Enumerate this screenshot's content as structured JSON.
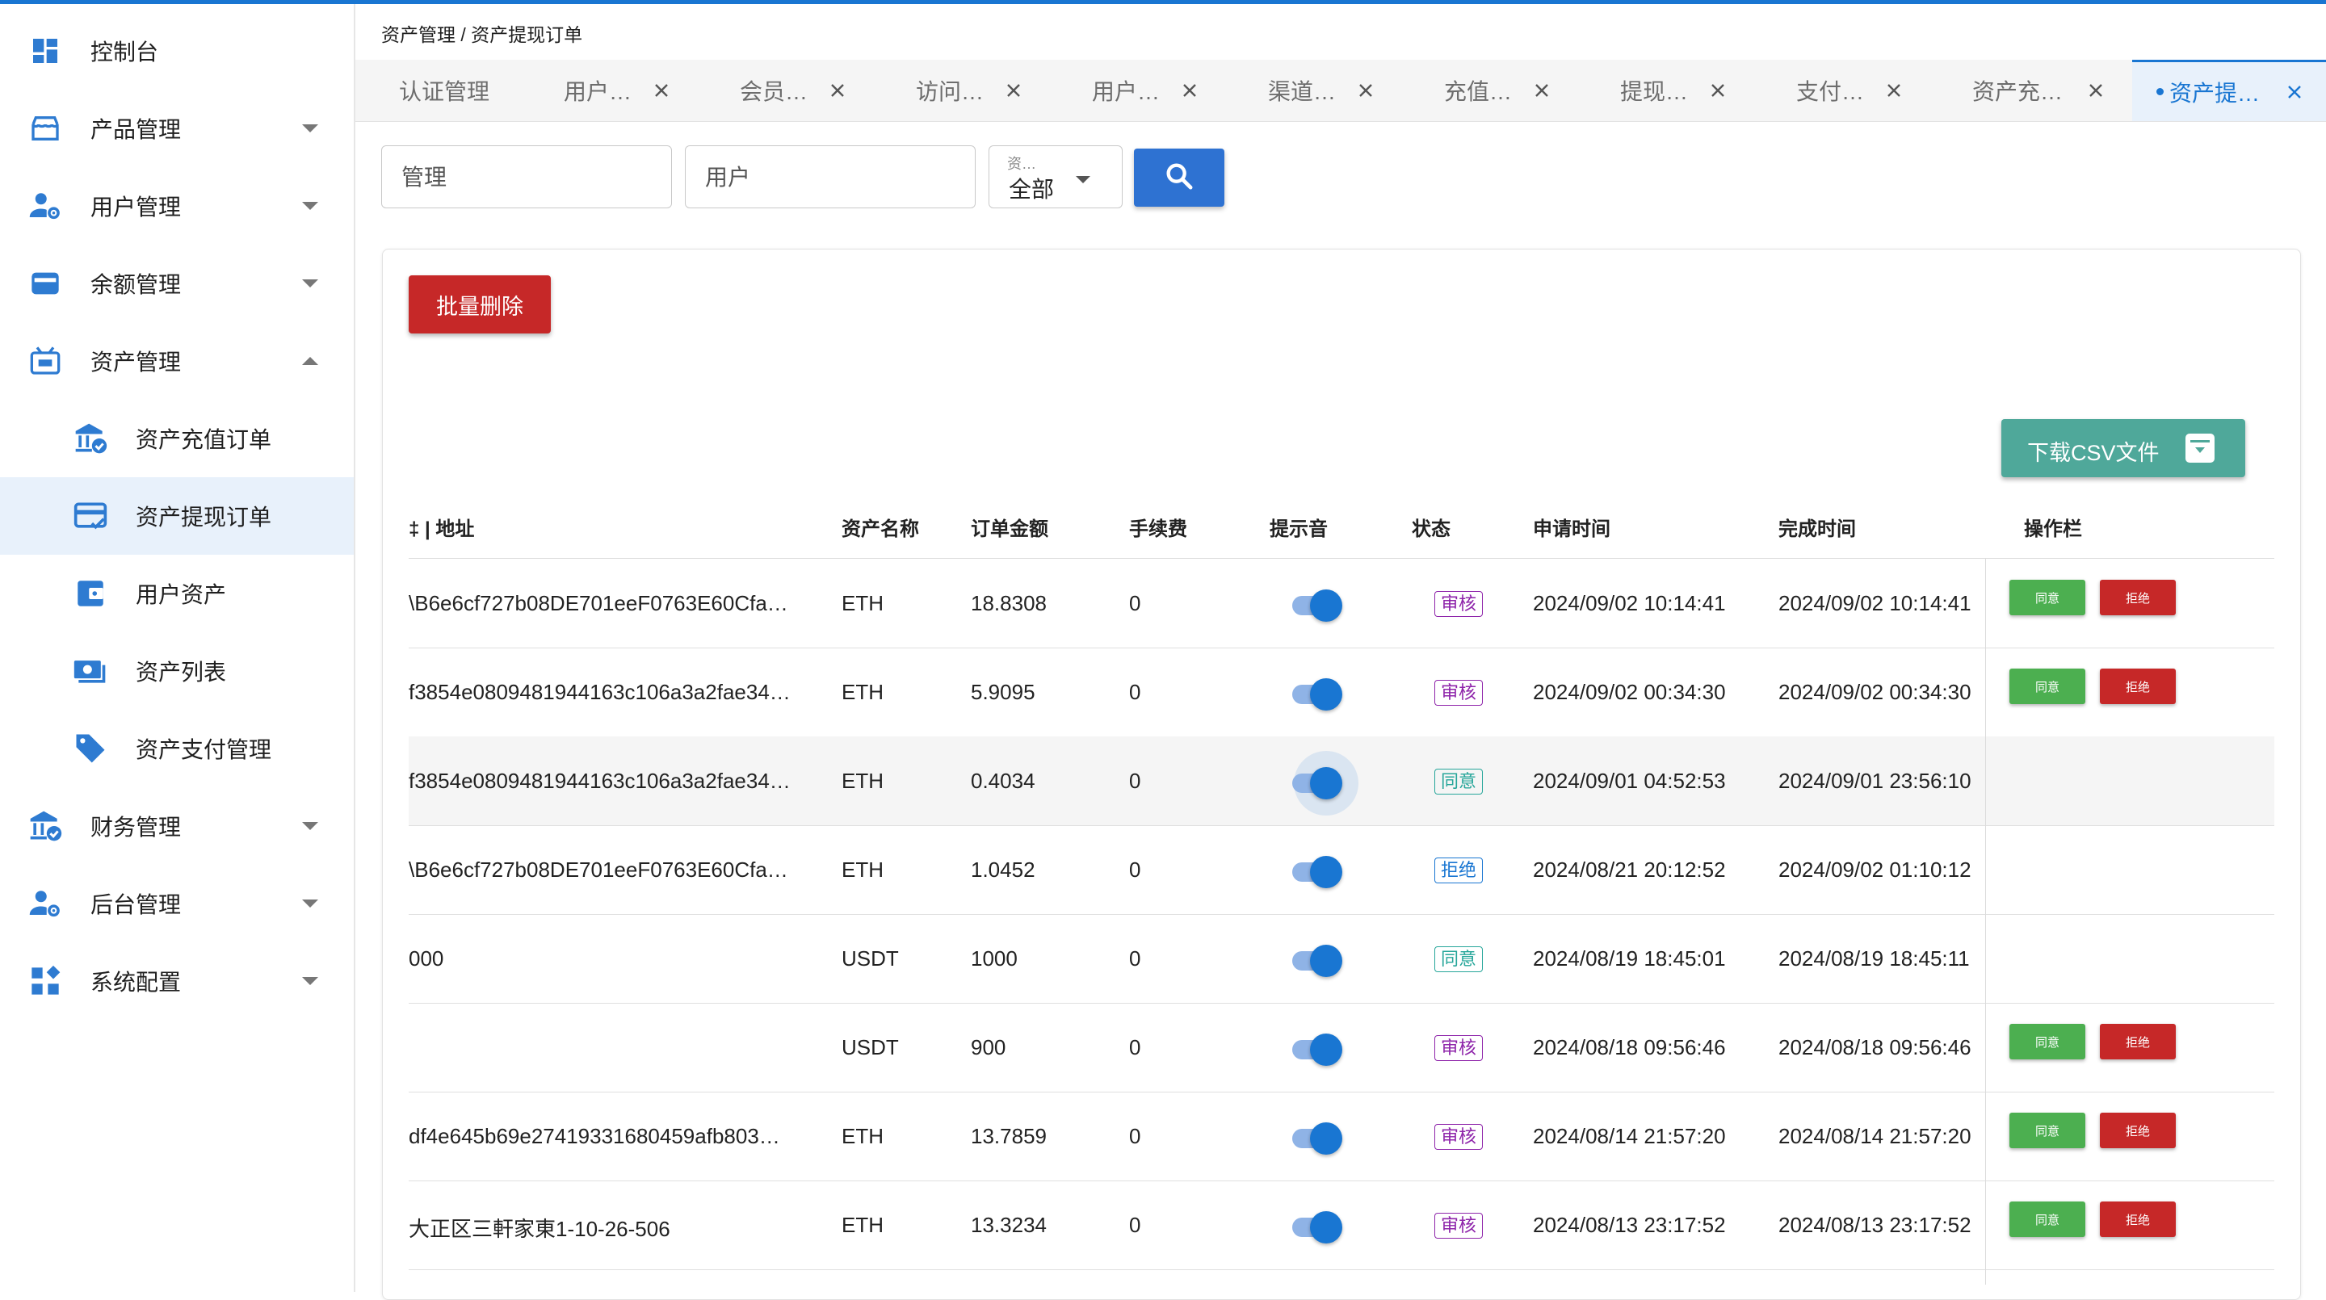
{
  "colors": {
    "primary": "#1976d2",
    "danger": "#c62828",
    "success": "#4caf50",
    "csv": "#4fa89a",
    "audit": "#8e24aa",
    "agree": "#26a69a"
  },
  "sidebar": {
    "items": [
      {
        "label": "控制台",
        "icon": "dashboard-icon"
      },
      {
        "label": "产品管理",
        "icon": "store-icon"
      },
      {
        "label": "用户管理",
        "icon": "user-settings-icon"
      },
      {
        "label": "余额管理",
        "icon": "wallet-card-icon"
      },
      {
        "label": "资产管理",
        "icon": "asset-box-icon"
      },
      {
        "label": "资产充值订单",
        "icon": "bank-check-icon"
      },
      {
        "label": "资产提现订单",
        "icon": "card-check-icon"
      },
      {
        "label": "用户资产",
        "icon": "wallet-icon"
      },
      {
        "label": "资产列表",
        "icon": "cash-icon"
      },
      {
        "label": "资产支付管理",
        "icon": "tag-icon"
      },
      {
        "label": "财务管理",
        "icon": "bank-icon"
      },
      {
        "label": "后台管理",
        "icon": "admin-settings-icon"
      },
      {
        "label": "系统配置",
        "icon": "widgets-icon"
      }
    ]
  },
  "breadcrumb": "资产管理 / 资产提现订单",
  "tabs": [
    "认证管理",
    "用户…",
    "会员…",
    "访问…",
    "用户…",
    "渠道…",
    "充值…",
    "提现…",
    "支付…",
    "资产充…",
    "资产提…"
  ],
  "filters": {
    "manage_placeholder": "管理",
    "user_placeholder": "用户",
    "select_label": "资…",
    "select_value": "全部"
  },
  "actions": {
    "batch_delete": "批量删除",
    "download_csv": "下载CSV文件"
  },
  "table": {
    "headers": [
      "‡ | 地址",
      "资产名称",
      "订单金额",
      "手续费",
      "提示音",
      "状态",
      "申请时间",
      "完成时间",
      "操作栏"
    ],
    "approve_label": "同意",
    "reject_label": "拒绝",
    "rows": [
      {
        "address": "\\B6e6cf727b08DE701eeF0763E60Cfa…",
        "asset": "ETH",
        "amount": "18.8308",
        "fee": "0",
        "status": "审核",
        "status_type": "audit",
        "apply_time": "2024/09/02 10:14:41",
        "done_time": "2024/09/02 10:14:41",
        "actions": true
      },
      {
        "address": "f3854e0809481944163c106a3a2fae34…",
        "asset": "ETH",
        "amount": "5.9095",
        "fee": "0",
        "status": "审核",
        "status_type": "audit",
        "apply_time": "2024/09/02 00:34:30",
        "done_time": "2024/09/02 00:34:30",
        "actions": true
      },
      {
        "address": "f3854e0809481944163c106a3a2fae34…",
        "asset": "ETH",
        "amount": "0.4034",
        "fee": "0",
        "status": "同意",
        "status_type": "agree",
        "apply_time": "2024/09/01 04:52:53",
        "done_time": "2024/09/01 23:56:10",
        "actions": false
      },
      {
        "address": "\\B6e6cf727b08DE701eeF0763E60Cfa…",
        "asset": "ETH",
        "amount": "1.0452",
        "fee": "0",
        "status": "拒绝",
        "status_type": "reject",
        "apply_time": "2024/08/21 20:12:52",
        "done_time": "2024/09/02 01:10:12",
        "actions": false
      },
      {
        "address": "000",
        "asset": "USDT",
        "amount": "1000",
        "fee": "0",
        "status": "同意",
        "status_type": "agree",
        "apply_time": "2024/08/19 18:45:01",
        "done_time": "2024/08/19 18:45:11",
        "actions": false
      },
      {
        "address": "",
        "asset": "USDT",
        "amount": "900",
        "fee": "0",
        "status": "审核",
        "status_type": "audit",
        "apply_time": "2024/08/18 09:56:46",
        "done_time": "2024/08/18 09:56:46",
        "actions": true
      },
      {
        "address": "df4e645b69e27419331680459afb803…",
        "asset": "ETH",
        "amount": "13.7859",
        "fee": "0",
        "status": "审核",
        "status_type": "audit",
        "apply_time": "2024/08/14 21:57:20",
        "done_time": "2024/08/14 21:57:20",
        "actions": true
      },
      {
        "address": "大正区三軒家東1-10-26-506",
        "asset": "ETH",
        "amount": "13.3234",
        "fee": "0",
        "status": "审核",
        "status_type": "audit",
        "apply_time": "2024/08/13 23:17:52",
        "done_time": "2024/08/13 23:17:52",
        "actions": true
      }
    ]
  }
}
